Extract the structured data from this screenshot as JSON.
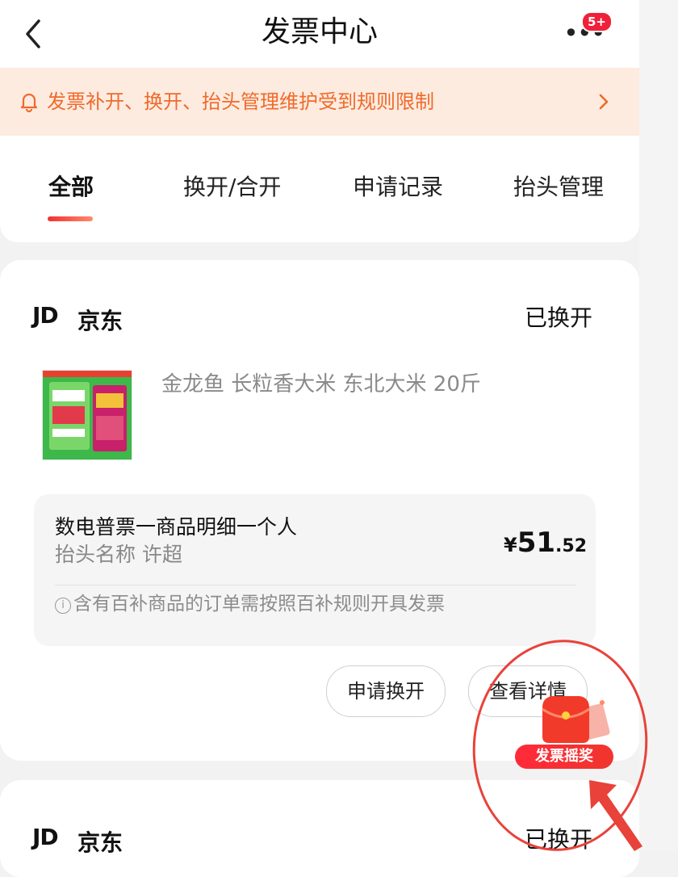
{
  "header": {
    "title": "发票中心",
    "badge": "5+"
  },
  "notice": {
    "text": "发票补开、换开、抬头管理维护受到规则限制"
  },
  "tabs": [
    {
      "label": "全部",
      "active": true
    },
    {
      "label": "换开/合开",
      "active": false
    },
    {
      "label": "申请记录",
      "active": false
    },
    {
      "label": "抬头管理",
      "active": false
    }
  ],
  "orders": [
    {
      "shop_logo": "JD",
      "shop_name": "京东",
      "status": "已换开",
      "product_name": "金龙鱼 长粒香大米 东北大米 20斤",
      "invoice": {
        "type": "数电普票一商品明细一个人",
        "title_label": "抬头名称",
        "title_value": "许超",
        "price_currency": "¥",
        "price_int": "51",
        "price_dec": ".52",
        "note": "含有百补商品的订单需按照百补规则开具发票"
      },
      "buttons": {
        "apply_reissue": "申请换开",
        "view_details": "查看详情"
      }
    },
    {
      "shop_logo": "JD",
      "shop_name": "京东",
      "status": "已换开"
    }
  ],
  "floating_widget": {
    "label": "发票摇奖"
  },
  "colors": {
    "accent": "#f23030",
    "notice_bg": "#fdebe0",
    "notice_text": "#f06a2a",
    "annotation": "#e8423a"
  }
}
